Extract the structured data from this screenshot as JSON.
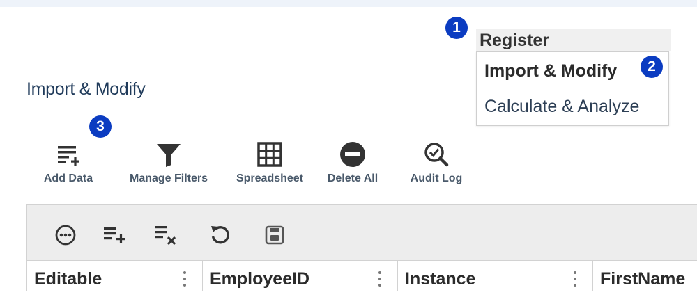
{
  "page": {
    "title": "Import & Modify"
  },
  "callouts": [
    "1",
    "2",
    "3"
  ],
  "menu": {
    "header": "Register",
    "items": [
      {
        "label": "Import & Modify",
        "active": true
      },
      {
        "label": "Calculate & Analyze",
        "active": false
      }
    ]
  },
  "toolbar": [
    {
      "label": "Add Data",
      "icon": "add-data-icon"
    },
    {
      "label": "Manage Filters",
      "icon": "filter-icon"
    },
    {
      "label": "Spreadsheet",
      "icon": "spreadsheet-icon"
    },
    {
      "label": "Delete All",
      "icon": "delete-all-icon"
    },
    {
      "label": "Audit Log",
      "icon": "audit-log-icon"
    }
  ],
  "grid": {
    "actions": [
      "more-options-icon",
      "add-row-icon",
      "delete-row-icon",
      "undo-icon",
      "save-icon"
    ],
    "columns": [
      "Editable",
      "EmployeeID",
      "Instance",
      "FirstName"
    ]
  },
  "colors": {
    "callout": "#0b3cc1",
    "title": "#1f3a5a",
    "toolbarLabel": "#4a5a6b",
    "gridBar": "#ededed"
  }
}
